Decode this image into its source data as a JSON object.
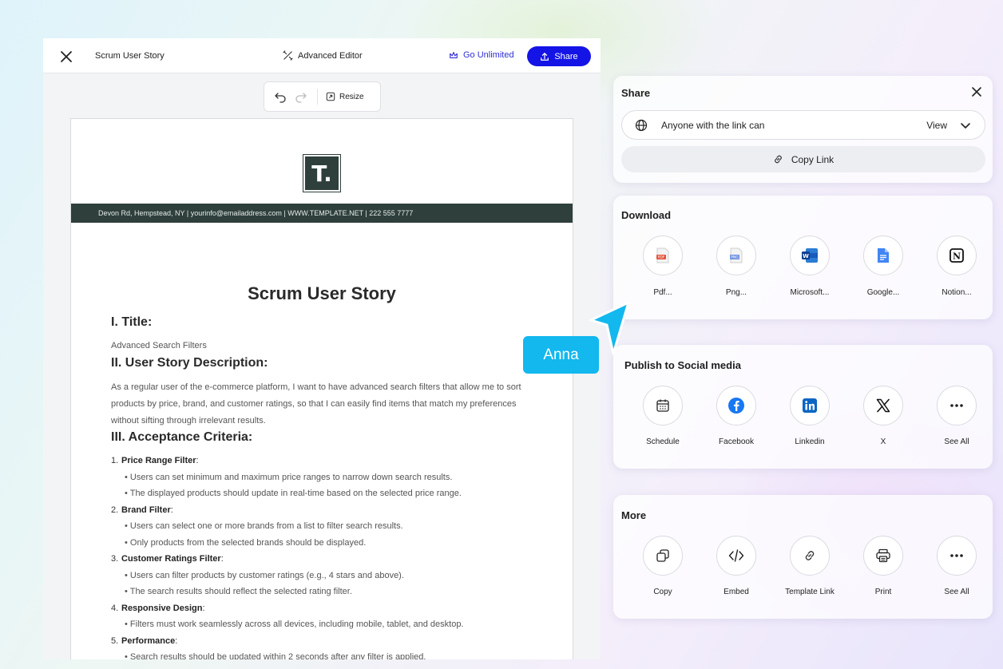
{
  "editor": {
    "doc_title": "Scrum User Story",
    "advanced_editor_label": "Advanced Editor",
    "go_unlimited_label": "Go Unlimited",
    "share_label": "Share",
    "resize_label": "Resize"
  },
  "document": {
    "logo_letter": "T.",
    "contact": "Devon Rd, Hempstead, NY | yourinfo@emailaddress.com | WWW.TEMPLATE.NET | 222 555 7777",
    "title": "Scrum User Story",
    "section1_heading": "I. Title:",
    "section1_text": "Advanced Search Filters",
    "section2_heading": "II. User Story Description:",
    "section2_text": "As a regular user of the e-commerce platform, I want to have advanced search filters that allow me to sort products by price, brand, and customer ratings, so that I can easily find items that match my preferences without sifting through irrelevant results.",
    "section3_heading": "III. Acceptance Criteria:",
    "criteria": [
      {
        "num": "1.",
        "title": "Price Range Filter",
        "items": [
          "Users can set minimum and maximum price ranges to narrow down search results.",
          "The displayed products should update in real-time based on the selected price range."
        ]
      },
      {
        "num": "2.",
        "title": "Brand Filter",
        "items": [
          "Users can select one or more brands from a list to filter search results.",
          "Only products from the selected brands should be displayed."
        ]
      },
      {
        "num": "3.",
        "title": "Customer Ratings Filter",
        "items": [
          "Users can filter products by customer ratings (e.g., 4 stars and above).",
          "The search results should reflect the selected rating filter."
        ]
      },
      {
        "num": "4.",
        "title": "Responsive Design",
        "items": [
          "Filters must work seamlessly across all devices, including mobile, tablet, and desktop."
        ]
      },
      {
        "num": "5.",
        "title": "Performance",
        "items": [
          "Search results should be updated within 2 seconds after any filter is applied."
        ]
      }
    ]
  },
  "share_panel": {
    "title": "Share",
    "access_label": "Anyone with the link can",
    "access_value": "View",
    "copy_link_label": "Copy Link"
  },
  "download_panel": {
    "title": "Download",
    "items": [
      "Pdf...",
      "Png...",
      "Microsoft...",
      "Google...",
      "Notion..."
    ]
  },
  "social_panel": {
    "title": "Publish to Social media",
    "items": [
      "Schedule",
      "Facebook",
      "Linkedin",
      "X",
      "See All"
    ]
  },
  "more_panel": {
    "title": "More",
    "items": [
      "Copy",
      "Embed",
      "Template Link",
      "Print",
      "See All"
    ]
  },
  "cursor": {
    "user_name": "Anna",
    "color": "#12b8ee"
  },
  "colors": {
    "accent": "#1414e6",
    "doc_header": "#2e3f3c"
  }
}
